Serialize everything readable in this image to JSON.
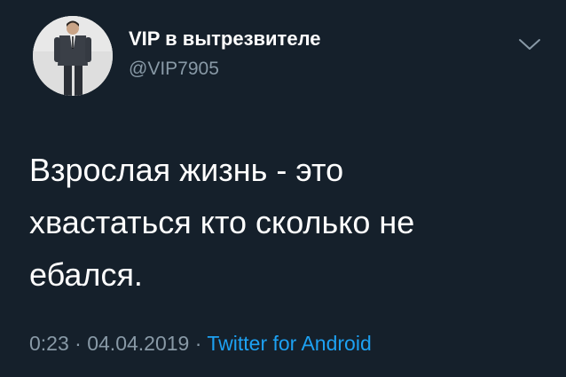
{
  "author": {
    "display_name": "VIP в вытрезвителе",
    "handle": "@VIP7905"
  },
  "tweet": {
    "text": "Взрослая жизнь - это\nхвастаться кто сколько не\nебался."
  },
  "meta": {
    "time": "0:23",
    "separator": " · ",
    "date": "04.04.2019",
    "source": "Twitter for Android"
  },
  "icons": {
    "menu": "chevron-down-icon",
    "avatar": "avatar"
  },
  "colors": {
    "background": "#15202b",
    "text": "#ffffff",
    "secondary": "#8899a6",
    "link": "#1da1f2"
  }
}
